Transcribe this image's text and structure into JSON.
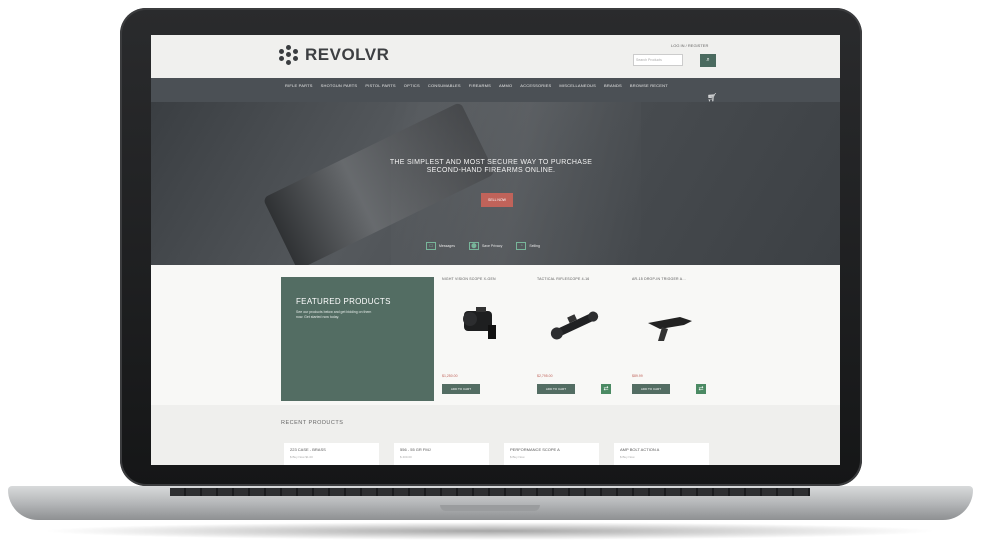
{
  "brand": {
    "name": "REVOLVR"
  },
  "header": {
    "login": "LOG IN / REGISTER",
    "search_placeholder": "Search Products",
    "search_btn": "⌕"
  },
  "nav": {
    "items": [
      "RIFLE PARTS",
      "SHOTGUN PARTS",
      "PISTOL PARTS",
      "OPTICS",
      "CONSUMABLES",
      "FIREARMS",
      "AMMO",
      "ACCESSORIES",
      "MISCELLANEOUS",
      "BRANDS",
      "BROWSE RECENT"
    ]
  },
  "hero": {
    "title": "THE SIMPLEST AND MOST SECURE WAY TO PURCHASE SECOND-HAND FIREARMS ONLINE.",
    "button": "SELL NOW",
    "features": [
      {
        "icon": "▭",
        "label": "Messages"
      },
      {
        "icon": "⬤",
        "label": "Save Privacy"
      },
      {
        "icon": "◔",
        "label": "Selling"
      }
    ]
  },
  "featured": {
    "title": "FEATURED PRODUCTS",
    "desc": "See our products below and get bidding on them now. Get started now today.",
    "products": [
      {
        "title": "NIGHT VISION SCOPE X-GEN",
        "price": "$1,250.00",
        "add": "ADD TO CART",
        "icon": "⇄"
      },
      {
        "title": "TACTICAL RIFLESCOPE 4-16",
        "price": "$2,795.00",
        "add": "ADD TO CART",
        "icon": "⇄"
      },
      {
        "title": "AR-15 DROP-IN TRIGGER A…",
        "price": "$89.99",
        "add": "ADD TO CART",
        "icon": "⇄"
      }
    ]
  },
  "recent": {
    "title": "RECENT PRODUCTS",
    "items": [
      {
        "t": "223 CASE - BRASS",
        "s": "$ Buy Now $1.00"
      },
      {
        "t": "556 - 55 GR FMJ",
        "s": "$ 400.00"
      },
      {
        "t": "PERFORMANCE SCOPE A",
        "s": "$ Buy Now"
      },
      {
        "t": "AMP BOLT ACTION A",
        "s": "$ Buy Now"
      }
    ]
  },
  "colors": {
    "accent": "#536d63",
    "cta": "#c0635a",
    "nav": "#4b5055"
  }
}
